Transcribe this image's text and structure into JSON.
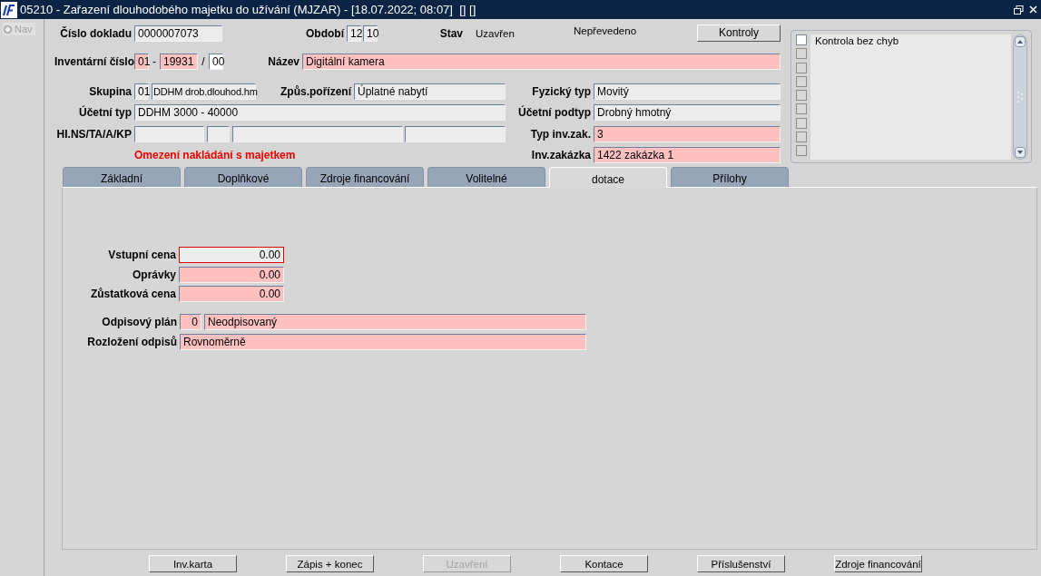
{
  "window": {
    "title": "05210 - Zařazení dlouhodobého majetku do užívání (MJZAR) - [18.07.2022; 08:07]  [] []"
  },
  "nav": {
    "label": "Nav",
    "selected": false,
    "disabled": true
  },
  "header": {
    "document_number": {
      "label": "Číslo dokladu",
      "value": "0000007073",
      "kind": "readonly"
    },
    "period": {
      "label": "Období",
      "parts": [
        {
          "value": "12",
          "kind": "readonly"
        },
        {
          "value": "10",
          "kind": "readonly"
        }
      ]
    },
    "status": {
      "label": "Stav",
      "value": "Uzavřen"
    },
    "transfer_status": "Nepřevedeno",
    "check_button": {
      "label": "Kontroly",
      "disabled": false
    },
    "inventory_number": {
      "label": "Inventární číslo",
      "parts": [
        {
          "value": "01",
          "kind": "required"
        },
        {
          "value": "19931",
          "kind": "required"
        },
        {
          "value": "00",
          "kind": "editable"
        }
      ],
      "separators": [
        "-",
        "/"
      ]
    },
    "name": {
      "label": "Název",
      "value": "Digitální kamera",
      "kind": "required"
    },
    "group": {
      "label": "Skupina",
      "parts": [
        {
          "value": "01",
          "kind": "readonly"
        },
        {
          "value": "DDHM drob.dlouhod.hm",
          "kind": "readonly"
        }
      ]
    },
    "acquisition": {
      "label": "Způs.pořízení",
      "value": "Úplatné nabytí",
      "kind": "readonly"
    },
    "physical_type": {
      "label": "Fyzický typ",
      "value": "Movitý",
      "kind": "readonly"
    },
    "accounting_type": {
      "label": "Účetní typ",
      "value": "DDHM 3000 - 40000",
      "kind": "readonly"
    },
    "accounting_subtype": {
      "label": "Účetní podtyp",
      "value": "Drobný hmotný",
      "kind": "readonly"
    },
    "hins": {
      "label": "HI.NS/TA/A/KP",
      "parts": [
        {
          "kind": "readonly"
        },
        {
          "kind": "readonly"
        },
        {
          "kind": "readonly"
        },
        {
          "kind": "readonly"
        }
      ]
    },
    "inv_order_type": {
      "label": "Typ inv.zak.",
      "value": "3",
      "kind": "required"
    },
    "warning": "Omezení nakládání s majetkem",
    "inv_order": {
      "label": "Inv.zakázka",
      "value": "1422 zakázka 1",
      "kind": "required"
    }
  },
  "checks": {
    "items": [
      {
        "label": "Kontrola bez chyb",
        "checked": false,
        "disabled": false
      },
      {
        "checked": false,
        "disabled": true
      },
      {
        "checked": false,
        "disabled": true
      },
      {
        "checked": false,
        "disabled": true
      },
      {
        "checked": false,
        "disabled": true
      },
      {
        "checked": false,
        "disabled": true
      },
      {
        "checked": false,
        "disabled": true
      },
      {
        "checked": false,
        "disabled": true
      },
      {
        "checked": false,
        "disabled": true
      }
    ]
  },
  "tabs": [
    {
      "label": "Základní",
      "selected": false
    },
    {
      "label": "Doplňkové",
      "selected": false
    },
    {
      "label": "Zdroje financování",
      "selected": false
    },
    {
      "label": "Volitelné",
      "selected": false
    },
    {
      "label": "dotace",
      "selected": true
    },
    {
      "label": "Přílohy",
      "selected": false
    }
  ],
  "tab_content": {
    "amounts": [
      {
        "label": "Vstupní cena",
        "value": "0.00",
        "kind": "focused"
      },
      {
        "label": "Oprávky",
        "value": "0.00",
        "kind": "required"
      },
      {
        "label": "Zůstatková cena",
        "value": "0.00",
        "kind": "required"
      }
    ],
    "depreciation_plan": {
      "label": "Odpisový plán",
      "parts": [
        {
          "value": "0",
          "kind": "required"
        },
        {
          "value": "Neodpisovaný",
          "kind": "required"
        }
      ]
    },
    "distribution": {
      "label": "Rozložení odpisů",
      "value": "Rovnoměrně",
      "kind": "required"
    }
  },
  "buttons": [
    {
      "label": "Inv.karta",
      "disabled": false
    },
    {
      "label": "Zápis + konec",
      "disabled": false
    },
    {
      "label": "Uzavření",
      "disabled": true
    },
    {
      "label": "Kontace",
      "disabled": false
    },
    {
      "label": "Příslušenství",
      "disabled": false
    },
    {
      "label": "Zdroje financování",
      "disabled": false
    }
  ]
}
